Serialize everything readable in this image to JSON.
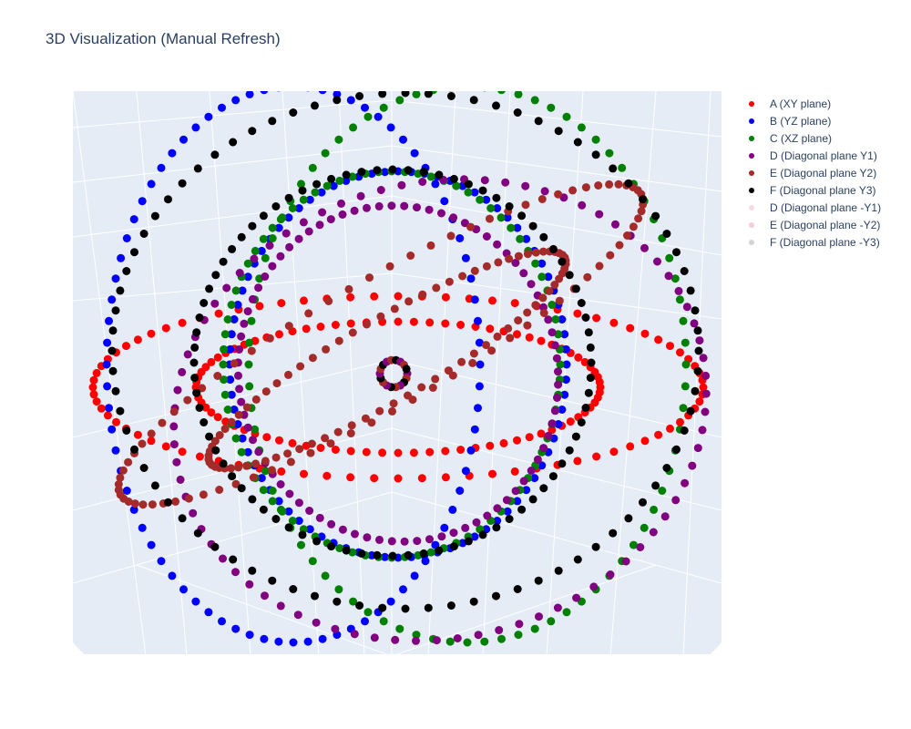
{
  "chart_data": {
    "type": "scatter",
    "mode": "3d-markers",
    "title": "3D Visualization (Manual Refresh)",
    "scene": {
      "bgcolor": "#e5ecf6",
      "grid": true,
      "gridcolor": "#ffffff",
      "axis_labels_shown": false
    },
    "legend_position": "top-right",
    "series": [
      {
        "name": "A (XY plane)",
        "color": "#ff0000",
        "opacity": 1,
        "shape": "ellipse",
        "points": 80,
        "rings": [
          {
            "center": [
              437,
              425
            ],
            "radii": [
              335,
              100
            ]
          },
          {
            "center": [
              437,
              425
            ],
            "radii": [
              222,
              72
            ]
          }
        ]
      },
      {
        "name": "B (YZ plane)",
        "color": "#0000ff",
        "opacity": 1,
        "shape": "ellipse",
        "points": 80,
        "rings": [
          {
            "center": [
              322,
              400
            ],
            "radii": [
              205,
              305
            ]
          },
          {
            "center": [
              437,
              400
            ],
            "radii": [
              185,
              212
            ]
          }
        ]
      },
      {
        "name": "C (XZ plane)",
        "color": "#008000",
        "opacity": 1,
        "shape": "ellipse",
        "points": 80,
        "rings": [
          {
            "center": [
              513,
              400
            ],
            "radii": [
              240,
              305
            ]
          },
          {
            "center": [
              430,
              400
            ],
            "radii": [
              185,
              212
            ]
          }
        ]
      },
      {
        "name": "D (Diagonal plane Y1)",
        "color": "#800080",
        "opacity": 1,
        "shape": "ellipse",
        "points": 80,
        "rings": [
          {
            "center": [
              483,
              450
            ],
            "radii": [
              295,
              250
            ],
            "tilt": -15
          },
          {
            "center": [
              437,
              410
            ],
            "radii": [
              175,
              185
            ],
            "tilt": -15
          }
        ]
      },
      {
        "name": "E (Diagonal plane Y2)",
        "color": "#a52a2a",
        "opacity": 1,
        "shape": "ellipse",
        "points": 80,
        "rings": [
          {
            "center": [
              418,
              378
            ],
            "radii": [
              330,
              70
            ],
            "tilt": -30
          },
          {
            "center": [
              425,
              395
            ],
            "radii": [
              225,
              45
            ],
            "tilt": -30
          }
        ]
      },
      {
        "name": "F (Diagonal plane Y3)",
        "color": "#000000",
        "opacity": 1,
        "shape": "ellipse",
        "points": 80,
        "rings": [
          {
            "center": [
              445,
              385
            ],
            "radii": [
              322,
              283
            ]
          },
          {
            "center": [
              431,
              398
            ],
            "radii": [
              218,
              212
            ]
          }
        ]
      },
      {
        "name": "D (Diagonal plane -Y1)",
        "color": "#f8d7e3",
        "opacity": 0.9,
        "shape": "ellipse",
        "points": 0,
        "rings": []
      },
      {
        "name": "E (Diagonal plane -Y2)",
        "color": "#f1c9d4",
        "opacity": 0.9,
        "shape": "ellipse",
        "points": 0,
        "rings": []
      },
      {
        "name": "F (Diagonal plane -Y3)",
        "color": "#cfcfd3",
        "opacity": 0.9,
        "shape": "ellipse",
        "points": 0,
        "rings": []
      }
    ],
    "center_cluster": {
      "center": [
        432,
        410
      ],
      "radius": 15,
      "colors": [
        "#800080",
        "#a52a2a",
        "#000000"
      ]
    }
  }
}
